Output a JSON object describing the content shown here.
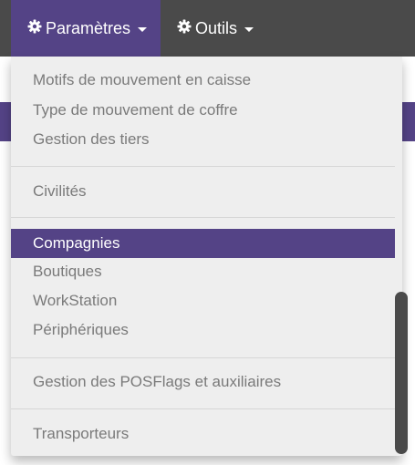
{
  "navbar": {
    "items": [
      {
        "label": "Paramètres",
        "icon": "gear-icon",
        "active": true
      },
      {
        "label": "Outils",
        "icon": "gear-icon",
        "active": false
      }
    ]
  },
  "dropdown": {
    "groups": [
      [
        "Motifs de mouvement en caisse",
        "Type de mouvement de coffre",
        "Gestion des tiers"
      ],
      [
        "Civilités"
      ],
      [
        "Compagnies",
        "Boutiques",
        "WorkStation",
        "Périphériques"
      ],
      [
        "Gestion des POSFlags et auxiliaires"
      ],
      [
        "Transporteurs"
      ]
    ],
    "active_item": "Compagnies"
  },
  "colors": {
    "navbar_bg": "#4a4a4a",
    "accent": "#544386",
    "menu_bg": "#eeeeee",
    "menu_text": "#7a7a7a"
  }
}
